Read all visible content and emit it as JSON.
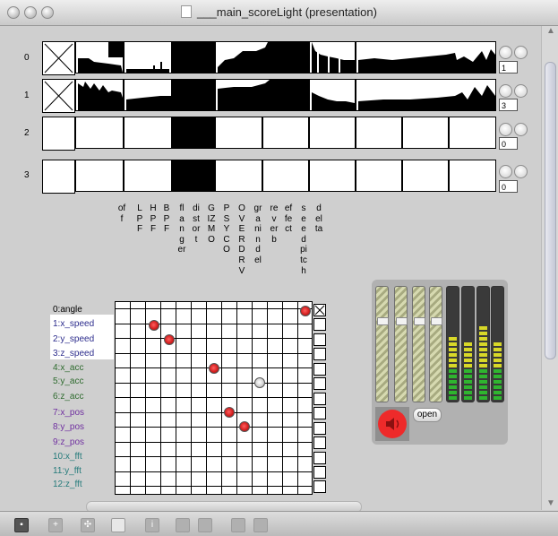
{
  "window": {
    "title": "___main_scoreLight (presentation)"
  },
  "score_rows": [
    {
      "index": "0",
      "number": "1"
    },
    {
      "index": "1",
      "number": "3"
    },
    {
      "index": "2",
      "number": "0"
    },
    {
      "index": "3",
      "number": "0"
    }
  ],
  "effect_labels": [
    "off",
    "LPF",
    "HPF",
    "BPF",
    "flanger",
    "distort",
    "GIZMO",
    "PSYCO",
    "OVERDRV",
    "granindel",
    "reverb",
    "effect",
    "seedpitch",
    "delta"
  ],
  "parameters": [
    {
      "label": "0:angle",
      "color": "#000000"
    },
    {
      "label": "1:x_speed",
      "color": "#2c2c8c"
    },
    {
      "label": "2:y_speed",
      "color": "#2c2c8c"
    },
    {
      "label": "3:z_speed",
      "color": "#2c2c8c"
    },
    {
      "label": "4:x_acc",
      "color": "#2e6b2e"
    },
    {
      "label": "5:y_acc",
      "color": "#2e6b2e"
    },
    {
      "label": "6:z_acc",
      "color": "#2e6b2e"
    },
    {
      "label": "7:x_pos",
      "color": "#7030a0"
    },
    {
      "label": "8:y_pos",
      "color": "#7030a0"
    },
    {
      "label": "9:z_pos",
      "color": "#7030a0"
    },
    {
      "label": "10:x_fft",
      "color": "#237a7a"
    },
    {
      "label": "11:y_fft",
      "color": "#237a7a"
    },
    {
      "label": "12:z_fft",
      "color": "#237a7a"
    }
  ],
  "mixer": {
    "open_label": "open"
  },
  "colors": {
    "window_bg": "#cfcfcf",
    "accent_red": "#ee2a2a",
    "meter_green": "#2fb52f",
    "meter_yellow": "#d8d828"
  },
  "toolbar": {
    "items": [
      "lock-icon",
      "add-icon",
      "move-icon",
      "inspector-icon",
      "info-icon",
      "copy-icon",
      "paste-icon",
      "grid-icon",
      "snap-icon"
    ]
  }
}
